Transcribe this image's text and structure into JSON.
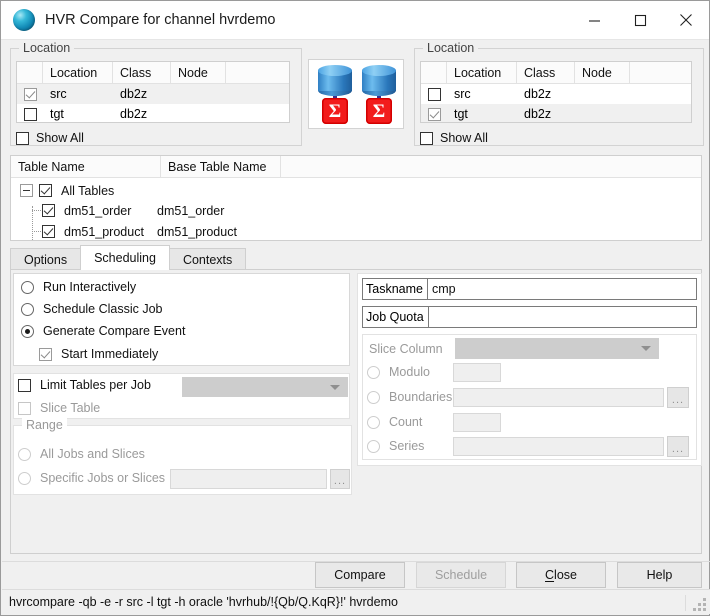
{
  "window": {
    "title": "HVR Compare for channel hvrdemo",
    "minimize_label": "Minimize",
    "maximize_label": "Maximize",
    "close_label": "Close"
  },
  "left_location": {
    "group_title": "Location",
    "columns": [
      "",
      "Location",
      "Class",
      "Node"
    ],
    "rows": [
      {
        "checked": true,
        "location": "src",
        "class": "db2z",
        "node": "",
        "selected": true
      },
      {
        "checked": false,
        "location": "tgt",
        "class": "db2z",
        "node": "",
        "selected": false
      }
    ],
    "show_all_label": "Show All",
    "show_all_checked": false
  },
  "right_location": {
    "group_title": "Location",
    "columns": [
      "",
      "Location",
      "Class",
      "Node"
    ],
    "rows": [
      {
        "checked": false,
        "location": "src",
        "class": "db2z",
        "node": "",
        "selected": false
      },
      {
        "checked": true,
        "location": "tgt",
        "class": "db2z",
        "node": "",
        "selected": true
      }
    ],
    "show_all_label": "Show All",
    "show_all_checked": false
  },
  "compare_icons": {
    "left_sigma": "Σ",
    "right_sigma": "Σ"
  },
  "tables": {
    "columns": [
      "Table Name",
      "Base Table Name"
    ],
    "root": {
      "label": "All Tables",
      "checked": true
    },
    "rows": [
      {
        "table_name": "dm51_order",
        "base_table_name": "dm51_order",
        "checked": true
      },
      {
        "table_name": "dm51_product",
        "base_table_name": "dm51_product",
        "checked": true
      }
    ]
  },
  "tabs": [
    {
      "label": "Options",
      "active": false
    },
    {
      "label": "Scheduling",
      "active": true
    },
    {
      "label": "Contexts",
      "active": false
    }
  ],
  "scheduling": {
    "mode_options": [
      {
        "label": "Run Interactively",
        "selected": false
      },
      {
        "label": "Schedule Classic Job",
        "selected": false
      },
      {
        "label": "Generate Compare Event",
        "selected": true
      }
    ],
    "start_immediately": {
      "label": "Start Immediately",
      "checked": true,
      "enabled": true
    },
    "limit_tables": {
      "label": "Limit Tables per Job",
      "checked": false,
      "value": "",
      "enabled": true
    },
    "slice_table": {
      "label": "Slice Table",
      "checked": false,
      "enabled": false
    },
    "range": {
      "group_title": "Range",
      "options": [
        {
          "label": "All Jobs and Slices",
          "selected": false,
          "enabled": false
        },
        {
          "label": "Specific Jobs or Slices",
          "selected": false,
          "enabled": false
        }
      ],
      "specific_value": "",
      "browse_label": "..."
    },
    "taskname": {
      "label": "Taskname",
      "value": "cmp"
    },
    "job_quota": {
      "label": "Job Quota",
      "value": ""
    },
    "slice": {
      "column_label": "Slice Column",
      "column_value": "",
      "options": [
        {
          "label": "Modulo",
          "selected": false,
          "value": "",
          "has_browse": false
        },
        {
          "label": "Boundaries",
          "selected": false,
          "value": "",
          "has_browse": true
        },
        {
          "label": "Count",
          "selected": false,
          "value": "",
          "has_browse": false
        },
        {
          "label": "Series",
          "selected": false,
          "value": "",
          "has_browse": true
        }
      ],
      "browse_label": "..."
    }
  },
  "footer": {
    "buttons": [
      {
        "name": "compare",
        "label": "Compare",
        "accel": "",
        "enabled": true,
        "default": true
      },
      {
        "name": "schedule",
        "label": "Schedule",
        "accel": "",
        "enabled": false,
        "default": false
      },
      {
        "name": "close",
        "label": "Close",
        "accel": "C",
        "enabled": true,
        "default": false
      },
      {
        "name": "help",
        "label": "Help",
        "accel": "",
        "enabled": true,
        "default": false
      }
    ]
  },
  "statusbar": {
    "command": "hvrcompare -qb -e -r src -l tgt -h oracle 'hvrhub/!{Qb/Q.KqR}!' hvrdemo"
  }
}
